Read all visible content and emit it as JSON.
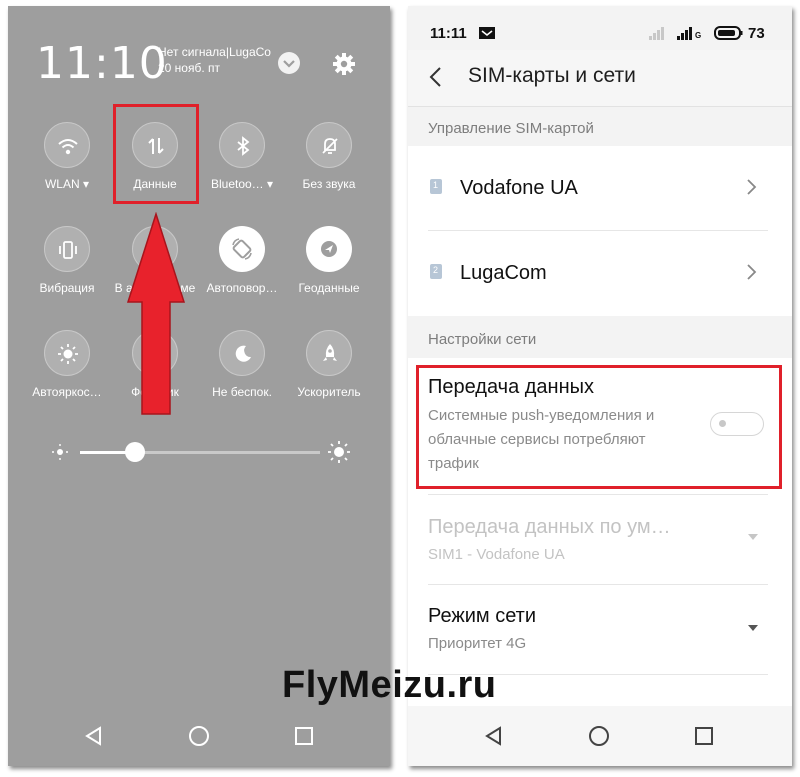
{
  "left_phone": {
    "clock": "11:10",
    "signal_text": "Нет сигнала|LugaCo",
    "date": "20 нояб. пт",
    "tiles": [
      {
        "label": "WLAN ▾",
        "icon": "wifi-icon"
      },
      {
        "label": "Данные",
        "icon": "data-transfer-icon"
      },
      {
        "label": "Bluetoo… ▾",
        "icon": "bluetooth-icon"
      },
      {
        "label": "Без звука",
        "icon": "mute-icon"
      },
      {
        "label": "Вибрация",
        "icon": "vibration-icon"
      },
      {
        "label": "В авиарежиме",
        "icon": "airplane-icon"
      },
      {
        "label": "Автоповор…",
        "icon": "auto-rotate-icon"
      },
      {
        "label": "Геоданные",
        "icon": "location-icon"
      },
      {
        "label": "Автояркос…",
        "icon": "auto-brightness-icon"
      },
      {
        "label": "Фонарик",
        "icon": "flashlight-icon"
      },
      {
        "label": "Не беспок.",
        "icon": "do-not-disturb-icon"
      },
      {
        "label": "Ускоритель",
        "icon": "rocket-icon"
      }
    ],
    "brightness_level": 0.23
  },
  "right_phone": {
    "status_time": "11:11",
    "battery": "73",
    "network_type": "G",
    "title": "SIM-карты и сети",
    "section_sim": "Управление SIM-картой",
    "sims": [
      {
        "number": "1",
        "name": "Vodafone UA"
      },
      {
        "number": "2",
        "name": "LugaCom"
      }
    ],
    "section_network": "Настройки сети",
    "data_transfer": {
      "title": "Передача данных",
      "subtitle": "Системные push-уведомления и облачные сервисы потребляют трафик",
      "enabled": false
    },
    "default_data": {
      "title": "Передача данных по ум…",
      "subtitle": "SIM1 - Vodafone UA"
    },
    "network_mode": {
      "title": "Режим сети",
      "subtitle": "Приоритет 4G"
    }
  },
  "watermark": "FlyMeizu.ru",
  "colors": {
    "highlight": "#e0202a"
  }
}
